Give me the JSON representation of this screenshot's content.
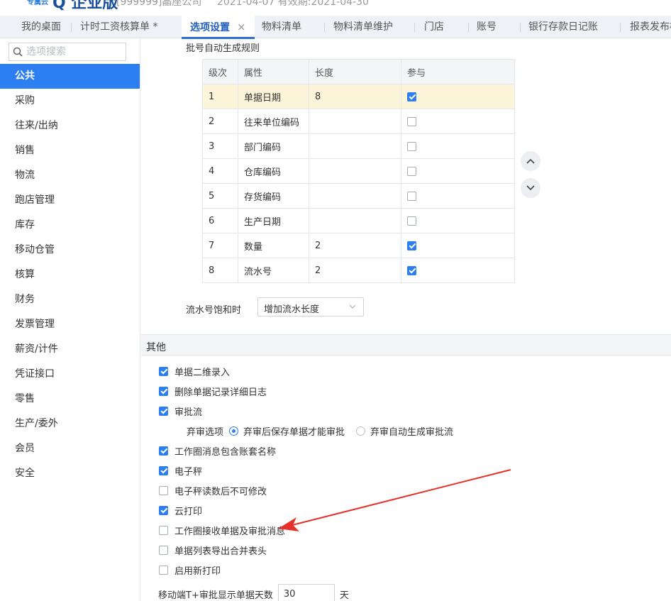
{
  "header": {
    "logo_sub": "专属云",
    "logo_main": "Q 企业版",
    "org": "[999999]晶座公司",
    "date_range": "2021-04-07  有效期:2021-04-30"
  },
  "tabs": [
    {
      "label": "我的桌面"
    },
    {
      "label": "计时工资核算单 *"
    },
    {
      "label": "选项设置",
      "close": "×"
    },
    {
      "label": "物料清单"
    },
    {
      "label": "物料清单维护"
    },
    {
      "label": "门店"
    },
    {
      "label": "账号"
    },
    {
      "label": "银行存款日记账"
    },
    {
      "label": "报表发布构"
    }
  ],
  "sidebar": {
    "search_placeholder": "选项搜索",
    "items": [
      {
        "label": "公共"
      },
      {
        "label": "采购"
      },
      {
        "label": "往来/出纳"
      },
      {
        "label": "销售"
      },
      {
        "label": "物流"
      },
      {
        "label": "跑店管理"
      },
      {
        "label": "库存"
      },
      {
        "label": "移动仓管"
      },
      {
        "label": "核算"
      },
      {
        "label": "财务"
      },
      {
        "label": "发票管理"
      },
      {
        "label": "薪资/计件"
      },
      {
        "label": "凭证接口"
      },
      {
        "label": "零售"
      },
      {
        "label": "生产/委外"
      },
      {
        "label": "会员"
      },
      {
        "label": "安全"
      }
    ]
  },
  "batch_rule": {
    "title": "批号自动生成规则",
    "columns": [
      "级次",
      "属性",
      "长度",
      "参与"
    ],
    "rows": [
      {
        "level": "1",
        "attr": "单据日期",
        "length": "8",
        "checked": true
      },
      {
        "level": "2",
        "attr": "往来单位编码",
        "length": "",
        "checked": false
      },
      {
        "level": "3",
        "attr": "部门编码",
        "length": "",
        "checked": false
      },
      {
        "level": "4",
        "attr": "仓库编码",
        "length": "",
        "checked": false
      },
      {
        "level": "5",
        "attr": "存货编码",
        "length": "",
        "checked": false
      },
      {
        "level": "6",
        "attr": "生产日期",
        "length": "",
        "checked": false
      },
      {
        "level": "7",
        "attr": "数量",
        "length": "2",
        "checked": true
      },
      {
        "level": "8",
        "attr": "流水号",
        "length": "2",
        "checked": true
      }
    ]
  },
  "saturation": {
    "label": "流水号饱和时",
    "value": "增加流水长度"
  },
  "other": {
    "title": "其他",
    "options": [
      {
        "label": "单据二维录入",
        "checked": true
      },
      {
        "label": "删除单据记录详细日志",
        "checked": true
      },
      {
        "label": "审批流",
        "checked": true
      },
      {
        "label": "工作圈消息包含账套名称",
        "checked": true
      },
      {
        "label": "电子秤",
        "checked": true
      },
      {
        "label": "电子秤读数后不可修改",
        "checked": false
      },
      {
        "label": "云打印",
        "checked": true
      },
      {
        "label": "工作圈接收单据及审批消息",
        "checked": false
      },
      {
        "label": "单据列表导出合并表头",
        "checked": false
      },
      {
        "label": "启用新打印",
        "checked": false
      }
    ],
    "approve": {
      "label": "弃审选项",
      "option1": "弃审后保存单据才能审批",
      "option2": "弃审自动生成审批流",
      "selected": 1
    },
    "mobile_days": {
      "label": "移动端T+审批显示单据天数",
      "value": "30",
      "unit": "天"
    }
  },
  "colors": {
    "accent": "#2d7ef0",
    "highlight_row": "#fdf5d9",
    "annotation_arrow": "#e8302a"
  }
}
